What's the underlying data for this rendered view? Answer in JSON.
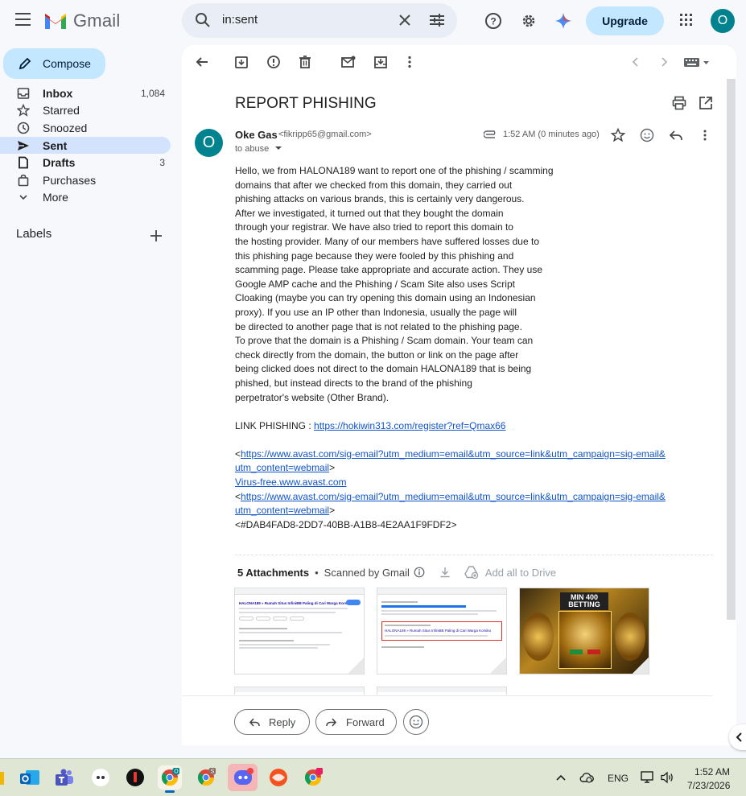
{
  "app": {
    "name": "Gmail"
  },
  "search": {
    "value": "in:sent"
  },
  "header": {
    "upgrade_label": "Upgrade",
    "account_initial": "O"
  },
  "sidebar": {
    "compose_label": "Compose",
    "items": [
      {
        "label": "Inbox",
        "count": "1,084"
      },
      {
        "label": "Starred",
        "count": ""
      },
      {
        "label": "Snoozed",
        "count": ""
      },
      {
        "label": "Sent",
        "count": ""
      },
      {
        "label": "Drafts",
        "count": "3"
      },
      {
        "label": "Purchases",
        "count": ""
      },
      {
        "label": "More",
        "count": ""
      }
    ],
    "labels_title": "Labels"
  },
  "message": {
    "subject": "REPORT PHISHING",
    "sender_initial": "O",
    "sender_name": "Oke Gas",
    "sender_email": "<fikripp65@gmail.com>",
    "to_line": "to abuse",
    "timestamp": "1:52 AM (0 minutes ago)",
    "body_lines": [
      "Hello, we from HALONA189 want to report one of the phishing / scamming",
      "domains that after we checked from this domain, they carried out",
      "phishing attacks on various brands, this is certainly very dangerous.",
      "After we investigated, it turned out that they bought the domain",
      "through your registrar. We have also tried to report this domain to",
      "the hosting provider. Many of our members have suffered losses due to",
      "this phishing page because they were fooled by this phishing and",
      "scamming page. Please take appropriate and accurate action. They use",
      "Google AMP cache and the Phishing / Scam Site also uses Script",
      "Cloaking (maybe you can try opening this domain using an Indonesian",
      "proxy). If you use an IP other than Indonesia, usually the page will",
      "be directed to another page that is not related to the phishing page.",
      "To prove that the domain is a Phishing / Scam domain. Your team can",
      "check directly from the domain, the button or link on the page after",
      "being clicked does not direct to the domain HALONA189 that is being",
      "phished, but instead directs to the brand of the phishing",
      "perpetrator's website (Other Brand)."
    ],
    "link_phishing_label": "LINK PHISHING : ",
    "link_phishing_url": "https://hokiwin313.com/register?ref=Qmax66",
    "avast_url_line1": "https://www.avast.com/sig-email?utm_medium=email&utm_source=link&utm_campaign=sig-email&",
    "avast_url_line2": "utm_content=webmail",
    "avast_virus_free": "Virus-free.www.avast.com",
    "avast_url2_line1": "https://www.avast.com/sig-email?utm_medium=email&utm_source=link&utm_campaign=sig-email&",
    "avast_url2_line2": "utm_content=webmail",
    "signature_id": "<#DAB4FAD8-2DD7-40BB-A1B8-4E2AA1F9FDF2>"
  },
  "attachments": {
    "title": "5 Attachments",
    "scanned": "Scanned by Gmail",
    "add_all": "Add all to Drive",
    "thumb1_title": "HALONA189 » Rumah Situs InfiniBB Paling di Cari Warga Korsiko",
    "thumb2_title": "HALONA189 » Rumah Situs InfiniBB Paling di Cari Warga Korsiko",
    "thumb3_text": "MIN 400 BETTING"
  },
  "actions": {
    "reply": "Reply",
    "forward": "Forward"
  },
  "taskbar": {
    "lang": "ENG",
    "time": "1:52 AM",
    "date": "7/23/2026"
  },
  "colors": {
    "accent": "#0b57d0",
    "compose_bg": "#c2e7ff",
    "avatar": "#00838f",
    "active_nav": "#d3e3fd"
  }
}
